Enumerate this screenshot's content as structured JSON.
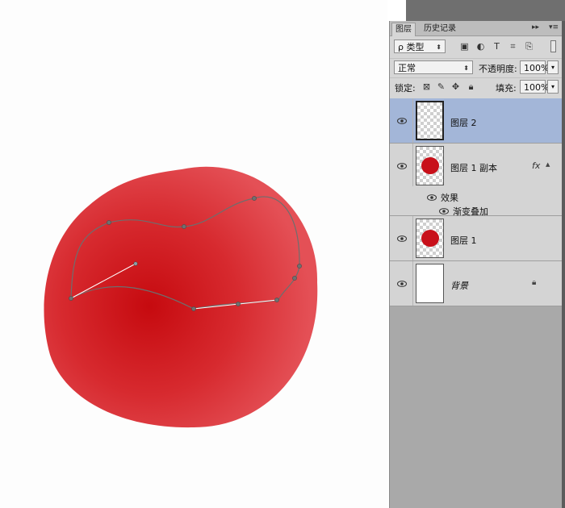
{
  "tabs": {
    "layers": "图层",
    "history": "历史记录"
  },
  "panel_controls": {
    "expand_arrows": "▸▸",
    "menu": "▾≡"
  },
  "filter": {
    "kind_label": "ρ 类型",
    "icons": [
      "image-filter-icon",
      "adjustment-filter-icon",
      "type-filter-icon",
      "shape-filter-icon",
      "smart-object-filter-icon"
    ]
  },
  "blend": {
    "mode": "正常",
    "opacity_label": "不透明度:",
    "opacity_value": "100%"
  },
  "lock": {
    "label": "锁定:",
    "fill_label": "填充:",
    "fill_value": "100%"
  },
  "layers": [
    {
      "name": "图层 2",
      "selected": true
    },
    {
      "name": "图层 1 副本",
      "fx": "fx",
      "effects_label": "效果",
      "effect_name": "渐变叠加"
    },
    {
      "name": "图层 1"
    },
    {
      "name": "背景",
      "locked": true
    }
  ],
  "colors": {
    "blob_center": "#c60a0f",
    "blob_edge": "#e24b50",
    "selected_layer": "#a3b6d8",
    "panel_bg": "#d6d6d6"
  }
}
